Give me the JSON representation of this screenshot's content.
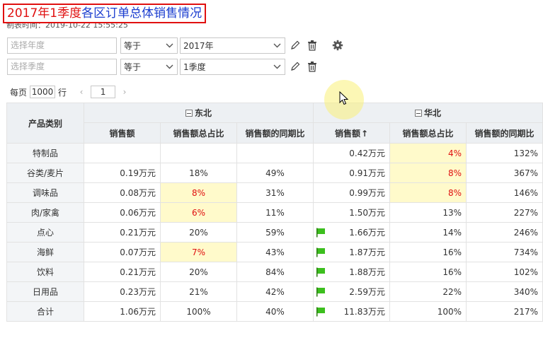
{
  "title": {
    "part_red": "2017年1季度",
    "part_blue": "各区订单总体销售情况"
  },
  "made_time": "制表时间：2019-10-22 15:55:25",
  "filters": [
    {
      "placeholder": "选择年度",
      "operator": "等于",
      "value": "2017年"
    },
    {
      "placeholder": "选择季度",
      "operator": "等于",
      "value": "1季度"
    }
  ],
  "pager": {
    "per_page_label": "每页",
    "per_page_value": "1000",
    "rows_label": "行",
    "prev": "‹",
    "page": "1",
    "next": "›"
  },
  "table": {
    "category_header": "产品类别",
    "groups": [
      "东北",
      "华北"
    ],
    "sub_headers": [
      "销售额",
      "销售额总占比",
      "销售额的同期比",
      "销售额",
      "销售额总占比",
      "销售额的同期比"
    ],
    "sort_indicator": "↑",
    "rows": [
      {
        "cat": "特制品",
        "ne_sales": "",
        "ne_share": "",
        "ne_yoy": "",
        "flag": false,
        "nc_sales": "0.42万元",
        "nc_share": "4%",
        "nc_yoy": "132%"
      },
      {
        "cat": "谷类/麦片",
        "ne_sales": "0.19万元",
        "ne_share": "18%",
        "ne_yoy": "49%",
        "flag": false,
        "nc_sales": "0.91万元",
        "nc_share": "8%",
        "nc_yoy": "367%"
      },
      {
        "cat": "调味品",
        "ne_sales": "0.08万元",
        "ne_share": "8%",
        "ne_yoy": "31%",
        "flag": false,
        "nc_sales": "0.99万元",
        "nc_share": "8%",
        "nc_yoy": "146%"
      },
      {
        "cat": "肉/家禽",
        "ne_sales": "0.06万元",
        "ne_share": "6%",
        "ne_yoy": "11%",
        "flag": false,
        "nc_sales": "1.50万元",
        "nc_share": "13%",
        "nc_yoy": "227%"
      },
      {
        "cat": "点心",
        "ne_sales": "0.21万元",
        "ne_share": "20%",
        "ne_yoy": "59%",
        "flag": true,
        "nc_sales": "1.66万元",
        "nc_share": "14%",
        "nc_yoy": "246%"
      },
      {
        "cat": "海鲜",
        "ne_sales": "0.07万元",
        "ne_share": "7%",
        "ne_yoy": "43%",
        "flag": true,
        "nc_sales": "1.87万元",
        "nc_share": "16%",
        "nc_yoy": "734%"
      },
      {
        "cat": "饮料",
        "ne_sales": "0.21万元",
        "ne_share": "20%",
        "ne_yoy": "84%",
        "flag": true,
        "nc_sales": "1.88万元",
        "nc_share": "16%",
        "nc_yoy": "102%"
      },
      {
        "cat": "日用品",
        "ne_sales": "0.23万元",
        "ne_share": "21%",
        "ne_yoy": "42%",
        "flag": true,
        "nc_sales": "2.59万元",
        "nc_share": "22%",
        "nc_yoy": "340%"
      },
      {
        "cat": "合计",
        "ne_sales": "1.06万元",
        "ne_share": "100%",
        "ne_yoy": "40%",
        "flag": true,
        "nc_sales": "11.83万元",
        "nc_share": "100%",
        "nc_yoy": "217%"
      }
    ]
  },
  "colors": {
    "highlight_bg": "#fffacb",
    "highlight_text": "#e01010",
    "title_red": "#e01010",
    "title_blue": "#1a3ccf",
    "flag_green": "#3cbf1e"
  }
}
